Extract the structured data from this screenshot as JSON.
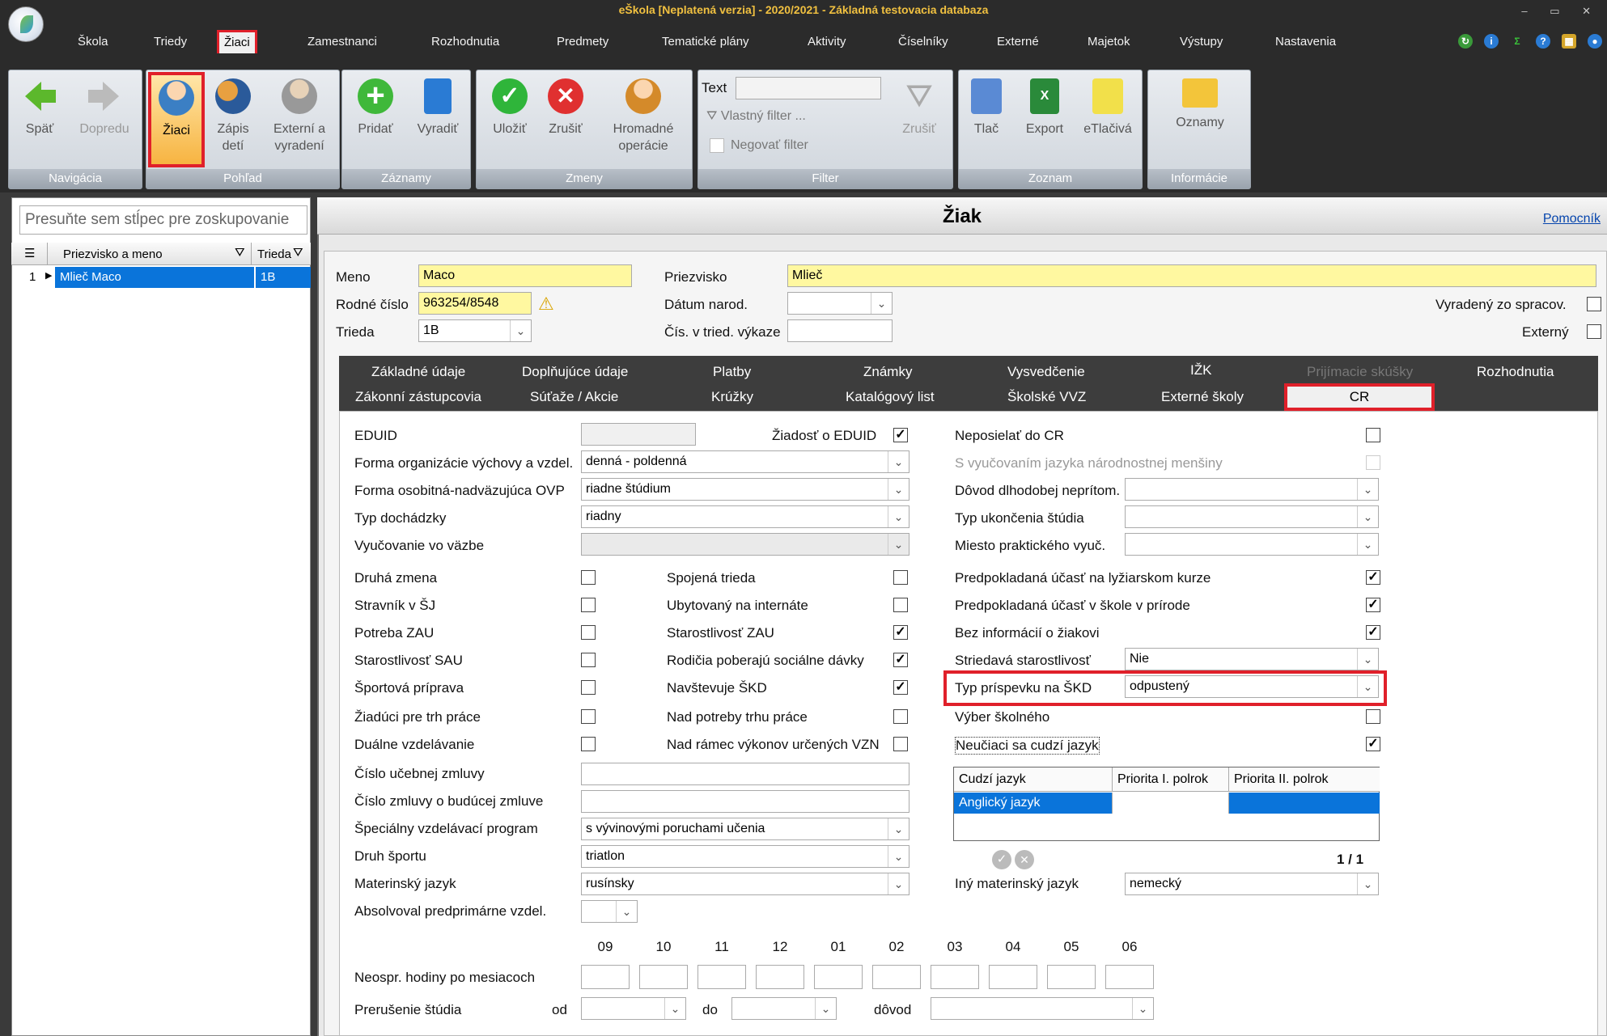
{
  "window": {
    "title": "eŠkola [Neplatená verzia] - 2020/2021 - Základná testovacia databaza",
    "controls": "–  ▭  ✕"
  },
  "menu": [
    "Škola",
    "Triedy",
    "Žiaci",
    "Zamestnanci",
    "Rozhodnutia",
    "Predmety",
    "Tematické plány",
    "Aktivity",
    "Číselníky",
    "Externé",
    "Majetok",
    "Výstupy",
    "Nastavenia"
  ],
  "ribbon": {
    "groups": {
      "nav": "Navigácia",
      "view": "Pohľad",
      "records": "Záznamy",
      "changes": "Zmeny",
      "filter": "Filter",
      "list": "Zoznam",
      "info": "Informácie"
    },
    "buttons": {
      "back": "Späť",
      "forward": "Dopredu",
      "students": "Žiaci",
      "enroll": "Zápis\ndetí",
      "external": "Externí a\nvyradení",
      "add": "Pridať",
      "remove": "Vyradiť",
      "save": "Uložiť",
      "cancel": "Zrušiť",
      "bulk": "Hromadné\noperácie",
      "filter_cancel": "Zrušiť",
      "print": "Tlač",
      "export": "Export",
      "eprint": "eTlačivá",
      "notices": "Oznamy"
    },
    "filter_text_label": "Text",
    "custom_filter": "Vlastný filter ...",
    "negate_filter": "Negovať filter"
  },
  "left": {
    "group_placeholder": "Presuňte sem stĺpec pre zoskupovanie",
    "col_name": "Priezvisko a meno",
    "col_class": "Trieda",
    "rows": [
      {
        "num": "1",
        "name": "Mlieč Maco",
        "class": "1B"
      }
    ]
  },
  "right": {
    "title": "Žiak",
    "help": "Pomocník"
  },
  "student": {
    "first_name_label": "Meno",
    "first_name": "Maco",
    "last_name_label": "Priezvisko",
    "last_name": "Mlieč",
    "birth_no_label": "Rodné číslo",
    "birth_no": "963254/8548",
    "dob_label": "Dátum narod.",
    "dob": "",
    "class_label": "Trieda",
    "class": "1B",
    "class_no_label": "Čís. v tried. výkaze",
    "class_no": "",
    "excluded_label": "Vyradený zo spracov.",
    "external_label": "Externý"
  },
  "tabs": {
    "row1": [
      "Základné údaje",
      "Doplňujúce údaje",
      "Platby",
      "Známky",
      "Vysvedčenie",
      "IŽK",
      "Prijímacie skúšky",
      "Rozhodnutia"
    ],
    "row2": [
      "Zákonní zástupcovia",
      "Súťaže / Akcie",
      "Krúžky",
      "Katalógový list",
      "Školské VVZ",
      "Externé školy",
      "CR"
    ]
  },
  "cr": {
    "eduid_label": "EDUID",
    "eduid_req_label": "Žiadosť o EDUID",
    "form_org_label": "Forma organizácie výchovy a vzdel.",
    "form_org": "denná - poldenná",
    "form_ovp_label": "Forma osobitná-nadväzujúca OVP",
    "form_ovp": "riadne štúdium",
    "attendance_label": "Typ dochádzky",
    "attendance": "riadny",
    "custody_label": "Vyučovanie vo väzbe",
    "second_shift": "Druhá zmena",
    "joined_class": "Spojená trieda",
    "boarder": "Stravník v ŠJ",
    "dorm": "Ubytovaný na internáte",
    "zau_need": "Potreba ZAU",
    "zau_care": "Starostlivosť ZAU",
    "sau_care": "Starostlivosť SAU",
    "social": "Rodičia poberajú sociálne dávky",
    "sport_prep": "Športová príprava",
    "skd": "Navštevuje ŠKD",
    "labor_market": "Žiadúci pre trh práce",
    "over_market": "Nad potreby trhu práce",
    "dual": "Duálne vzdelávanie",
    "over_vzn": "Nad rámec výkonov určených VZN",
    "contract_label": "Číslo učebnej zmluvy",
    "future_contract_label": "Číslo zmluvy o budúcej zmluve",
    "special_prog_label": "Špeciálny vzdelávací program",
    "special_prog": "s vývinovými poruchami učenia",
    "sport_label": "Druh športu",
    "sport": "triatlon",
    "mother_tongue_label": "Materinský jazyk",
    "mother_tongue": "rusínsky",
    "preprimary_label": "Absolvoval predprimárne vzdel.",
    "no_cr_label": "Neposielať do CR",
    "minority_label": "S vyučovaním jazyka národnostnej menšiny",
    "absence_reason_label": "Dôvod dlhodobej neprítom.",
    "end_type_label": "Typ ukončenia štúdia",
    "practice_label": "Miesto praktického vyuč.",
    "ski_label": "Predpokladaná účasť na lyžiarskom kurze",
    "nature_label": "Predpokladaná účasť v škole v prírode",
    "no_info_label": "Bez informácií o žiakovi",
    "alt_care_label": "Striedavá starostlivosť",
    "alt_care": "Nie",
    "skd_fee_label": "Typ príspevku na ŠKD",
    "skd_fee": "odpustený",
    "school_choice_label": "Výber školného",
    "no_foreign_label": "Neučiaci sa cudzí jazyk",
    "lang_cols": [
      "Cudzí jazyk",
      "Priorita I. polrok",
      "Priorita II. polrok"
    ],
    "lang_rows": [
      [
        "Anglický jazyk",
        "",
        ""
      ]
    ],
    "pager": "1 / 1",
    "other_tongue_label": "Iný materinský jazyk",
    "other_tongue": "nemecký",
    "months": [
      "09",
      "10",
      "11",
      "12",
      "01",
      "02",
      "03",
      "04",
      "05",
      "06"
    ],
    "unexcused_label": "Neospr. hodiny po mesiacoch",
    "interrupt_label": "Prerušenie štúdia",
    "from": "od",
    "to": "do",
    "reason": "dôvod"
  },
  "colors": {
    "accent_red": "#e0202a",
    "selection": "#0a74da",
    "yellow_field": "#fff8a0"
  }
}
